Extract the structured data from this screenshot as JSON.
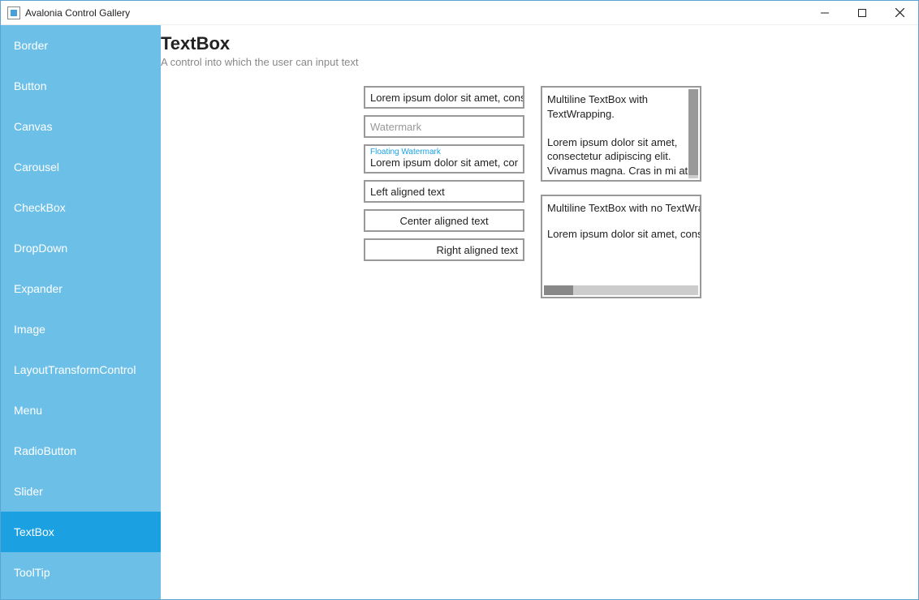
{
  "window": {
    "title": "Avalonia Control Gallery"
  },
  "sidebar": {
    "items": [
      {
        "label": "Border"
      },
      {
        "label": "Button"
      },
      {
        "label": "Canvas"
      },
      {
        "label": "Carousel"
      },
      {
        "label": "CheckBox"
      },
      {
        "label": "DropDown"
      },
      {
        "label": "Expander"
      },
      {
        "label": "Image"
      },
      {
        "label": "LayoutTransformControl"
      },
      {
        "label": "Menu"
      },
      {
        "label": "RadioButton"
      },
      {
        "label": "Slider"
      },
      {
        "label": "TextBox"
      },
      {
        "label": "ToolTip"
      }
    ],
    "selected_index": 12
  },
  "page": {
    "title": "TextBox",
    "subtitle": "A control into which the user can input text"
  },
  "textboxes": {
    "simple": "Lorem ipsum dolor sit amet, consec",
    "watermark_placeholder": "Watermark",
    "floating_label": "Floating Watermark",
    "floating_value": "Lorem ipsum dolor sit amet, consec",
    "left": "Left aligned text",
    "center": "Center aligned text",
    "right": "Right aligned text",
    "multiline_wrap": "Multiline TextBox with TextWrapping.\n\nLorem ipsum dolor sit amet, consectetur adipiscing elit. Vivamus magna. Cras in mi at felis aliquet congue. Ut a est eget",
    "multiline_nowrap_line1": "Multiline TextBox with no TextWrapp",
    "multiline_nowrap_line2": "Lorem ipsum dolor sit amet, consec"
  }
}
